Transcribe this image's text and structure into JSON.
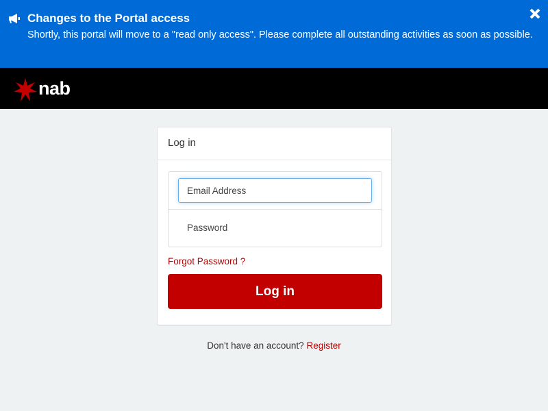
{
  "banner": {
    "icon": "megaphone-icon",
    "title": "Changes to the Portal access",
    "message": "Shortly, this portal will move to a \"read only access\". Please complete all outstanding activities as soon as possible.",
    "close_icon": "close-icon",
    "background": "#006bd6"
  },
  "header": {
    "logo_text": "nab",
    "logo_star_color": "#c20000",
    "background": "#000000"
  },
  "login_card": {
    "title": "Log in",
    "email_placeholder": "Email Address",
    "password_placeholder": "Password",
    "forgot_password": "Forgot Password ?",
    "submit_label": "Log in",
    "accent": "#c20000"
  },
  "footer": {
    "no_account_text": "Don't have an account?",
    "register_link": "Register"
  }
}
